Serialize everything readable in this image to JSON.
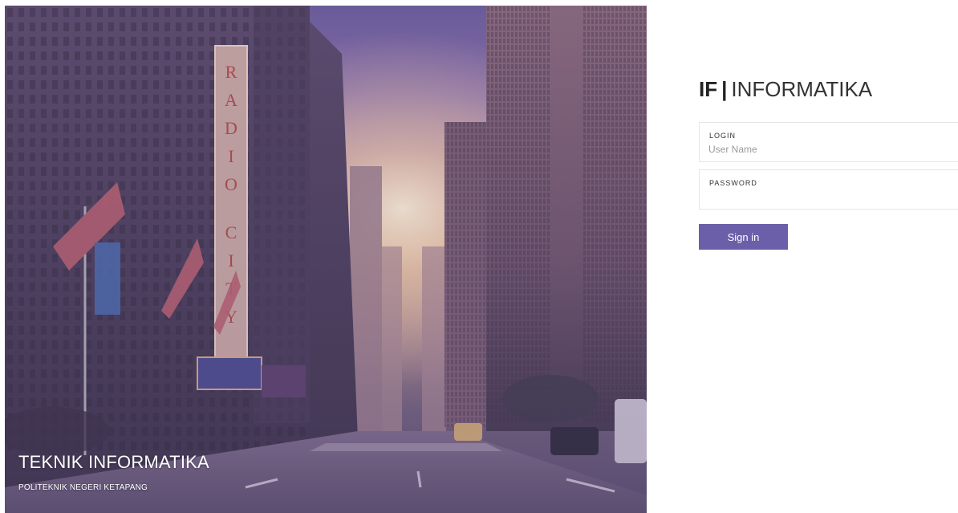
{
  "hero": {
    "title": "TEKNIK INFORMATIKA",
    "subtitle": "POLITEKNIK NEGERI KETAPANG",
    "sign_text": "RADIO CITY"
  },
  "brand": {
    "abbr": "IF",
    "separator": "|",
    "name": "INFORMATIKA"
  },
  "form": {
    "login_label": "LOGIN",
    "login_placeholder": "User Name",
    "login_value": "",
    "password_label": "PASSWORD",
    "password_value": "",
    "submit_label": "Sign in"
  },
  "colors": {
    "accent": "#6a5fa8",
    "hero_overlay": "#5f5096"
  }
}
